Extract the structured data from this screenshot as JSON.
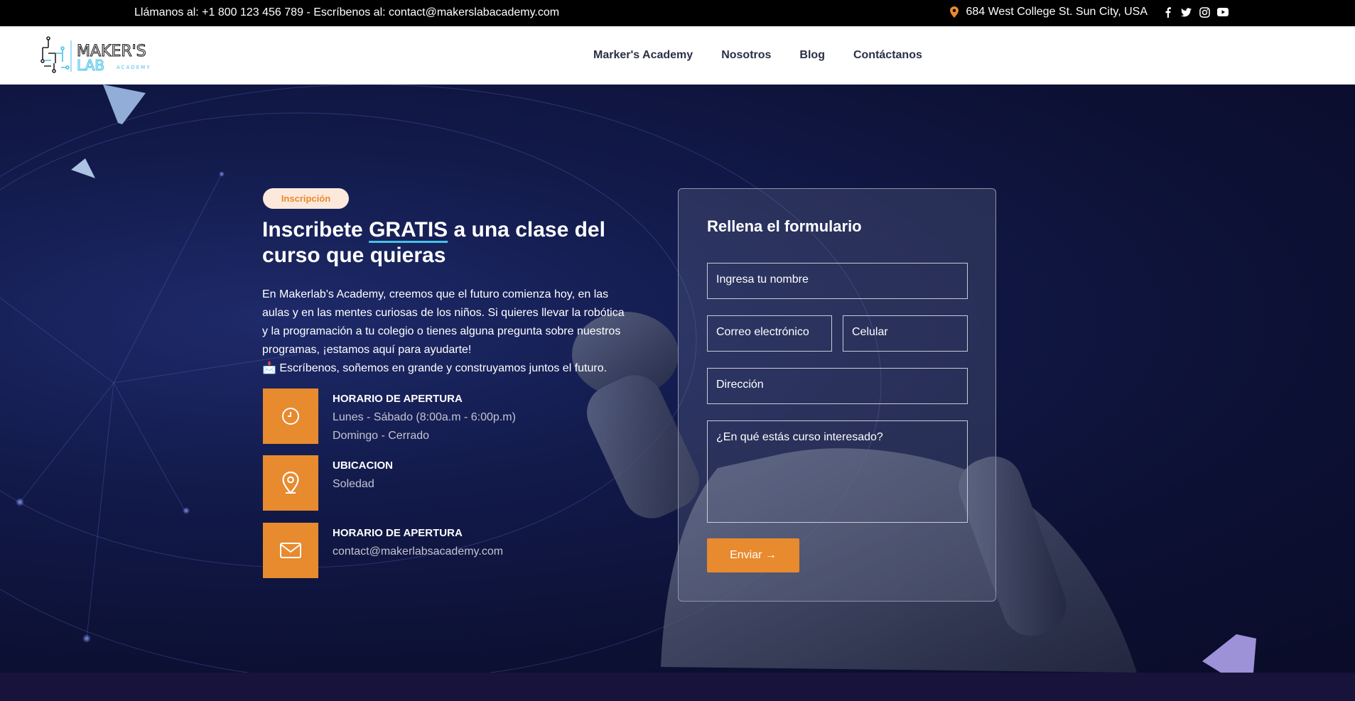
{
  "topbar": {
    "contact": "Llámanos al: +1 800 123 456 789 - Escríbenos al: contact@makerslabacademy.com",
    "address": "684 West College St. Sun City, USA",
    "icons": [
      "map-pin-icon",
      "facebook-icon",
      "twitter-icon",
      "instagram-icon",
      "youtube-icon"
    ]
  },
  "header": {
    "logo_text": "MAKER'S LAB ACADEMY",
    "nav": [
      "Marker's Academy",
      "Nosotros",
      "Blog",
      "Contáctanos"
    ]
  },
  "hero": {
    "badge": "Inscripción",
    "title_pre": "Inscribete ",
    "title_highlight": "GRATIS",
    "title_post": " a una clase del curso que quieras",
    "description": "En Makerlab's Academy, creemos que el futuro comienza hoy, en las aulas y en las mentes curiosas de los niños. Si quieres llevar la robótica y la programación a tu colegio o tienes alguna pregunta sobre nuestros programas, ¡estamos aquí para ayudarte!",
    "description_2": "📩 Escríbenos, soñemos en grande y construyamos juntos el futuro.",
    "info": [
      {
        "label": "HORARIO DE APERTURA",
        "line1": "Lunes - Sábado (8:00a.m - 6:00p.m)",
        "line2": "Domingo - Cerrado",
        "icon": "clock-icon"
      },
      {
        "label": "UBICACION",
        "line1": "Soledad",
        "icon": "location-pin-icon"
      },
      {
        "label": "HORARIO DE APERTURA",
        "line1": "contact@makerlabsacademy.com",
        "icon": "envelope-icon"
      }
    ]
  },
  "form": {
    "title": "Rellena el formulario",
    "name_placeholder": "Ingresa tu nombre",
    "email_placeholder": "Correo electrónico",
    "phone_placeholder": "Celular",
    "address_placeholder": "Dirección",
    "message_placeholder": "¿En qué estás curso interesado?",
    "submit": "Enviar →"
  },
  "colors": {
    "accent": "#e88a2e",
    "highlight_underline": "#46c1e8",
    "header_bg": "#ffffff",
    "topbar_bg": "#000000",
    "hero_bg": "#0c1033"
  }
}
